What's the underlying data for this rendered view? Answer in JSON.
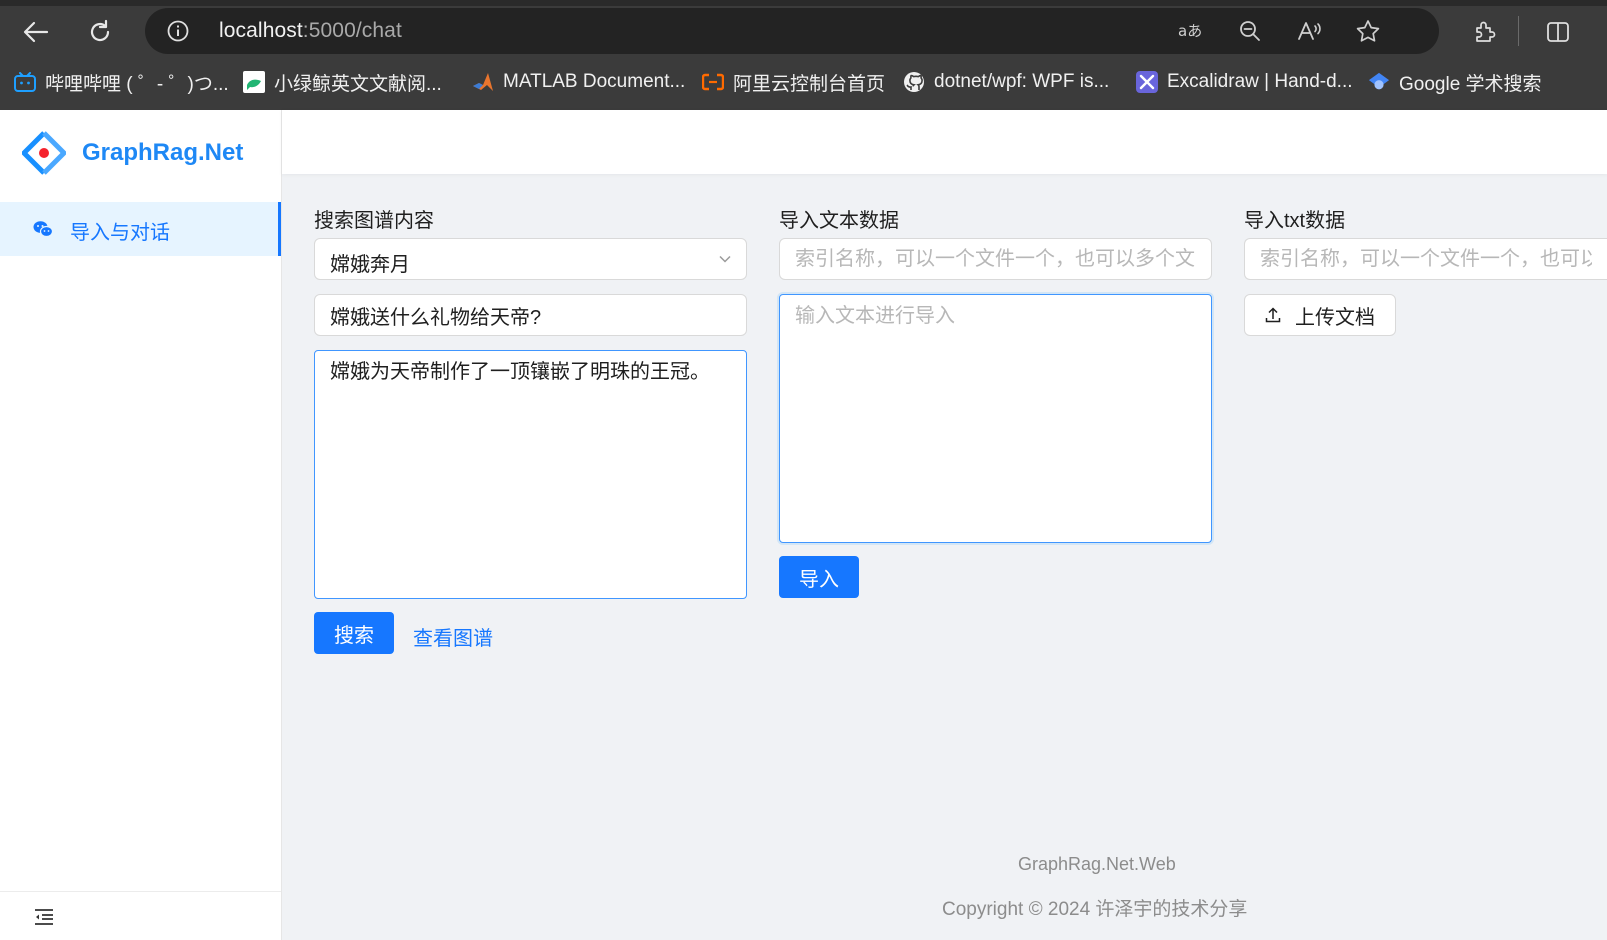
{
  "browser": {
    "url_host": "localhost",
    "url_path": ":5000/chat",
    "bookmarks": [
      {
        "label": "哔哩哔哩 ( ゜- ゜)つ...",
        "icon": "bilibili-icon"
      },
      {
        "label": "小绿鲸英文文献阅...",
        "icon": "whale-icon"
      },
      {
        "label": "MATLAB Document...",
        "icon": "matlab-icon"
      },
      {
        "label": "阿里云控制台首页",
        "icon": "aliyun-icon"
      },
      {
        "label": "dotnet/wpf: WPF is...",
        "icon": "github-icon"
      },
      {
        "label": "Excalidraw | Hand-d...",
        "icon": "excalidraw-icon"
      },
      {
        "label": "Google 学术搜索",
        "icon": "google-scholar-icon"
      }
    ]
  },
  "app": {
    "logo_text": "GraphRag.Net",
    "menu": [
      {
        "label": "导入与对话",
        "icon": "wechat-icon",
        "active": true
      }
    ]
  },
  "search": {
    "label": "搜索图谱内容",
    "selected_graph": "嫦娥奔月",
    "question": "嫦娥送什么礼物给天帝?",
    "answer": "嫦娥为天帝制作了一顶镶嵌了明珠的王冠。",
    "search_button": "搜索",
    "view_graph_link": "查看图谱"
  },
  "import_text": {
    "label": "导入文本数据",
    "index_placeholder": "索引名称，可以一个文件一个，也可以多个文...",
    "text_placeholder": "输入文本进行导入",
    "import_button": "导入"
  },
  "import_txt": {
    "label": "导入txt数据",
    "index_placeholder": "索引名称，可以一个文件一个，也可以多个文件一个",
    "upload_button": "上传文档"
  },
  "footer": {
    "line1": "GraphRag.Net.Web",
    "line2": "Copyright © 2024 许泽宇的技术分享"
  },
  "colors": {
    "primary": "#1677ff",
    "logo": "#1e88f5",
    "background": "#f0f2f5"
  }
}
